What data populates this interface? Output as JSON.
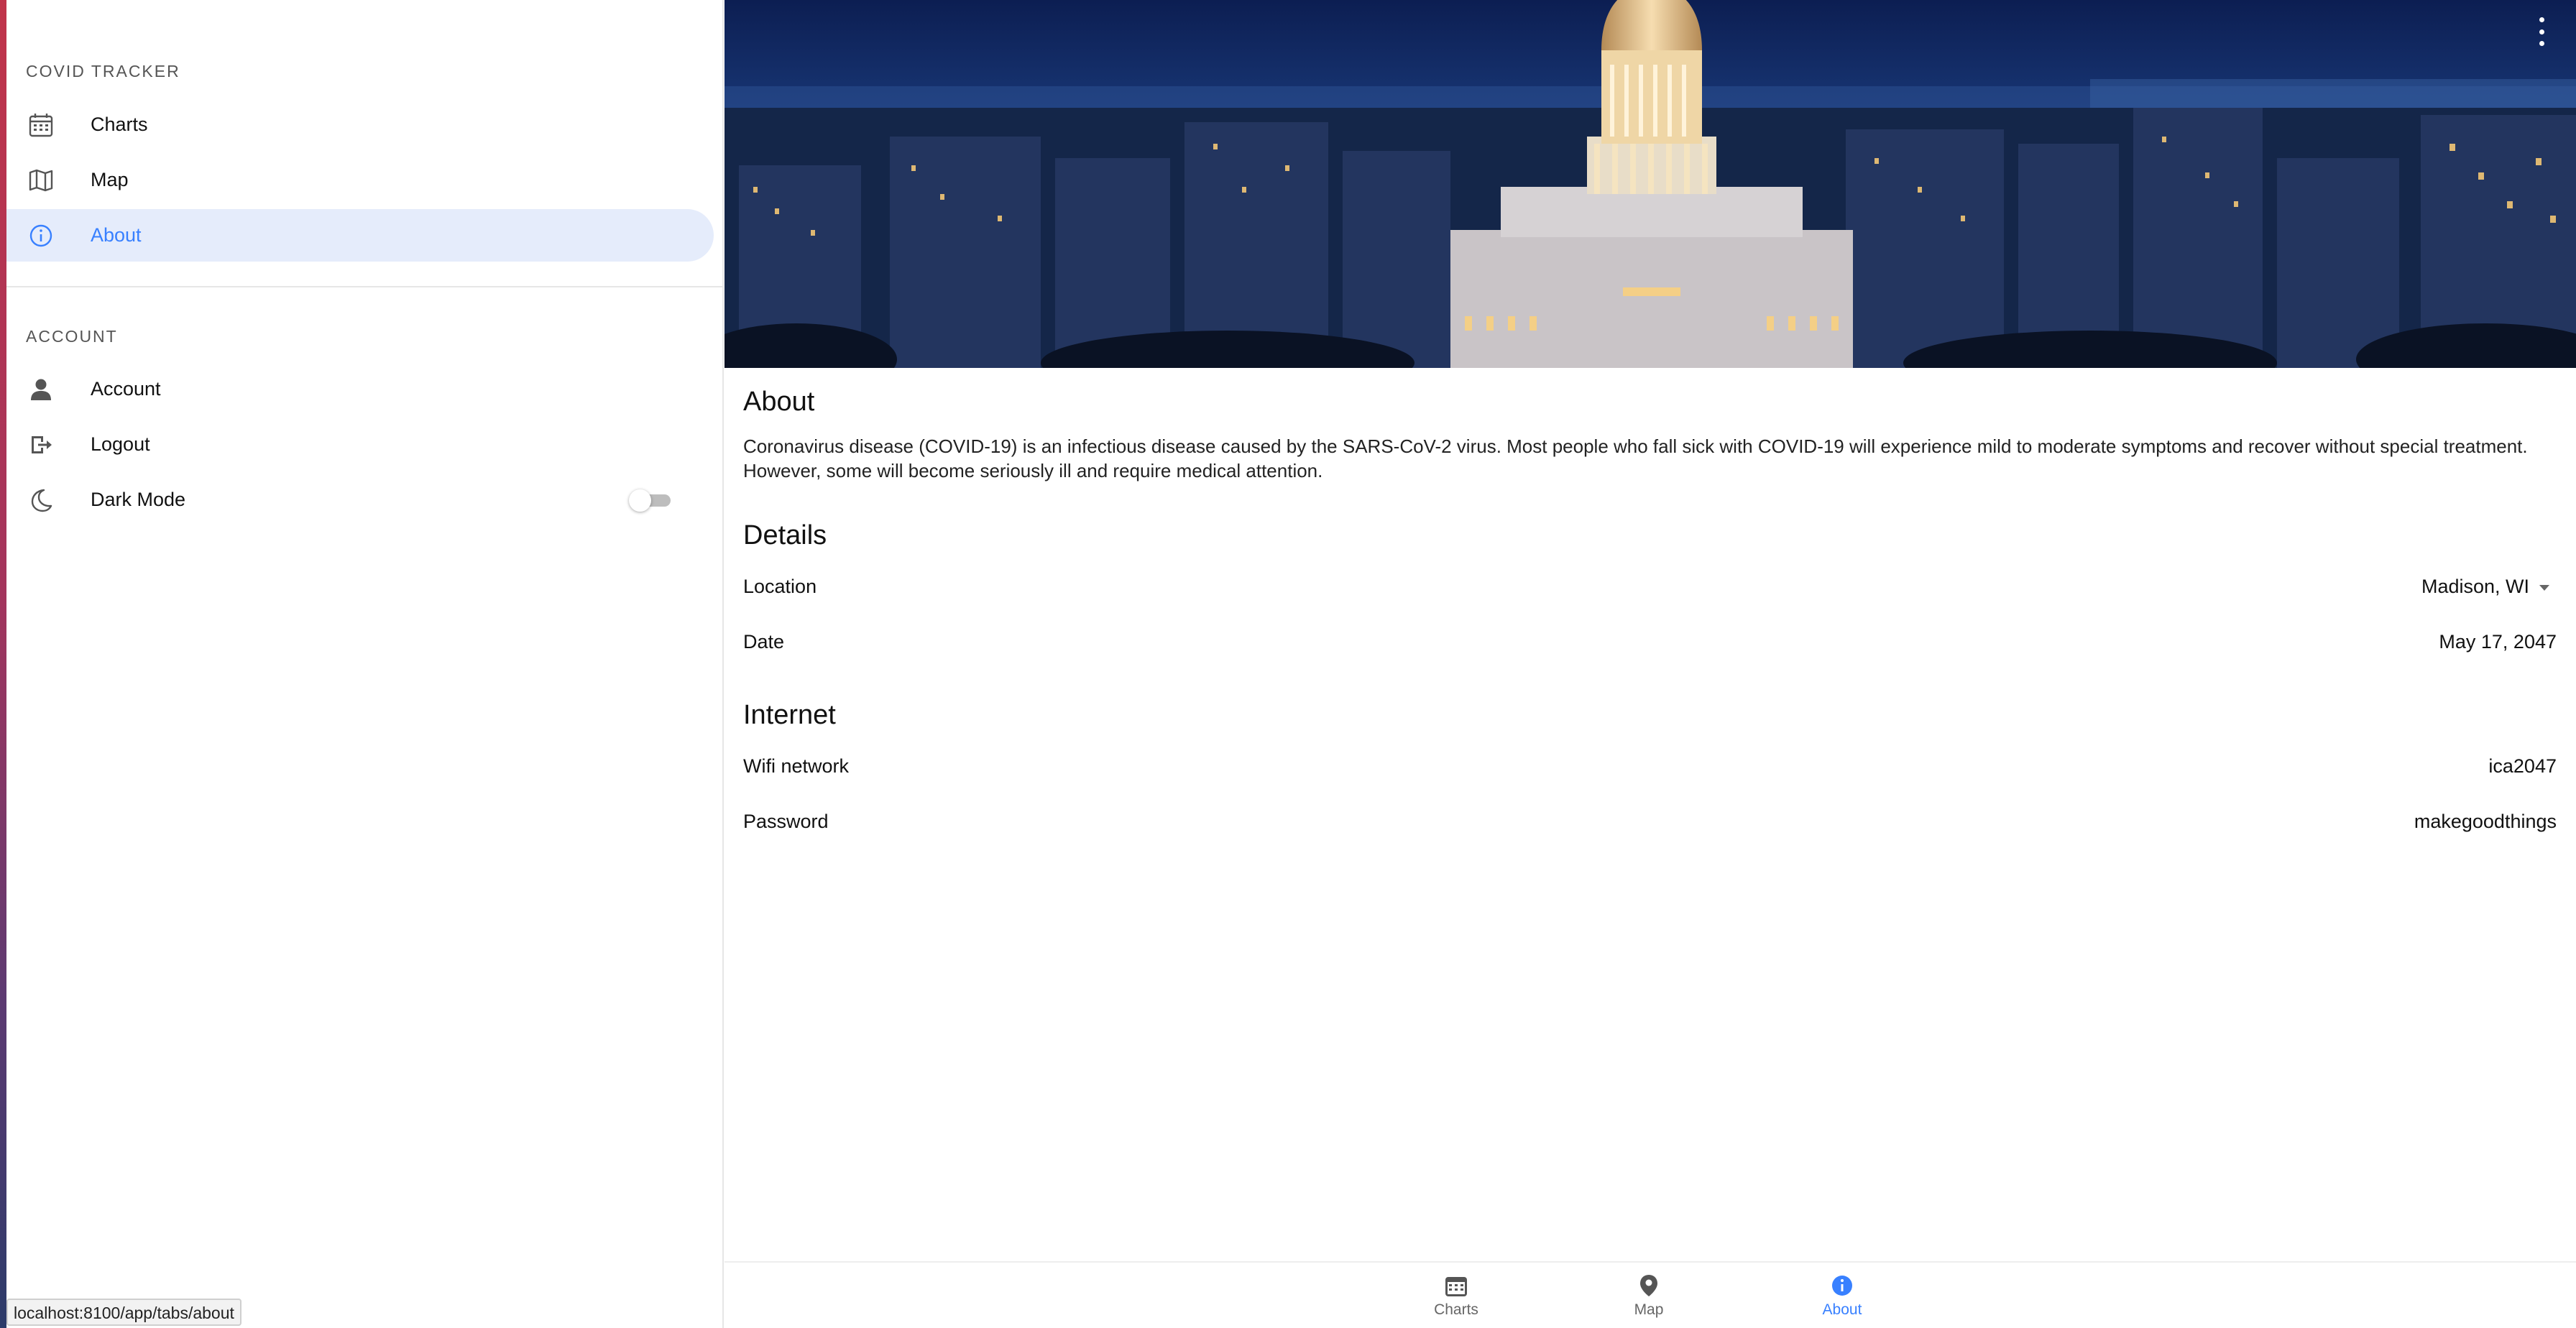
{
  "sidebar": {
    "tracker_title": "COVID TRACKER",
    "nav_items": [
      {
        "label": "Charts",
        "icon": "calendar-icon"
      },
      {
        "label": "Map",
        "icon": "map-icon"
      },
      {
        "label": "About",
        "icon": "info-icon",
        "selected": true
      }
    ],
    "account_title": "ACCOUNT",
    "account_items": [
      {
        "label": "Account",
        "icon": "person-icon"
      },
      {
        "label": "Logout",
        "icon": "logout-icon"
      },
      {
        "label": "Dark Mode",
        "icon": "moon-icon",
        "toggle": false
      }
    ]
  },
  "status_bar": {
    "url": "localhost:8100/app/tabs/about"
  },
  "main": {
    "hero": {
      "image": "madison-capitol-night-photo"
    },
    "more_icon": "more-vertical-icon",
    "about": {
      "title": "About",
      "text": "Coronavirus disease (COVID-19) is an infectious disease caused by the SARS-CoV-2 virus. Most people who fall sick with COVID-19 will experience mild to moderate symptoms and recover without special treatment. However, some will become seriously ill and require medical attention."
    },
    "details": {
      "title": "Details",
      "location_label": "Location",
      "location_value": "Madison, WI",
      "date_label": "Date",
      "date_value": "May 17, 2047"
    },
    "internet": {
      "title": "Internet",
      "wifi_label": "Wifi network",
      "wifi_value": "ica2047",
      "password_label": "Password",
      "password_value": "makegoodthings"
    }
  },
  "tabbar": {
    "tabs": [
      {
        "label": "Charts",
        "icon": "calendar-icon"
      },
      {
        "label": "Map",
        "icon": "location-pin-icon"
      },
      {
        "label": "About",
        "icon": "info-icon",
        "active": true
      }
    ]
  },
  "colors": {
    "accent": "#3880ff",
    "selected_bg": "#e5ecfb",
    "night_sky": "#0d1f4d"
  }
}
